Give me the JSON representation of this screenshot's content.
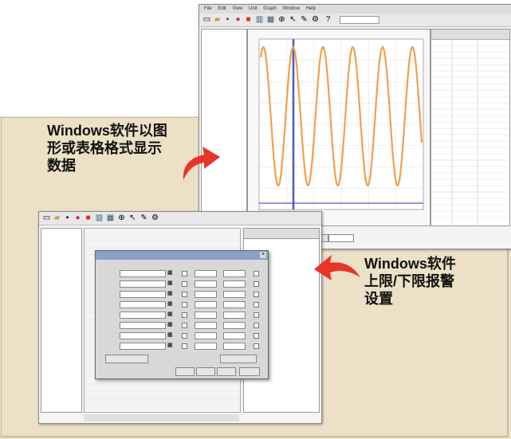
{
  "callout_top": {
    "lines": [
      "Windows软件以图",
      "形或表格格式显示",
      "数据"
    ]
  },
  "callout_bottom": {
    "lines": [
      "Windows软件",
      "上限/下限报警",
      "设置"
    ]
  },
  "chart_window": {
    "menu": [
      "File",
      "Edit",
      "View",
      "Unit",
      "Graph",
      "Window",
      "Help"
    ],
    "tree": {
      "root": "",
      "items": [
        "",
        "",
        "",
        "",
        ""
      ]
    },
    "chart_xlabel": "",
    "status": "",
    "tabs": [
      "",
      ""
    ],
    "table_headers": [
      "",
      "",
      ""
    ]
  },
  "alarm_window": {
    "tree": {
      "items": [
        "",
        ""
      ]
    },
    "dialog": {
      "title": "",
      "col_headers": [
        "",
        "",
        "",
        ""
      ],
      "rows": [
        {
          "label": "",
          "value": ""
        },
        {
          "label": "",
          "value": ""
        },
        {
          "label": "",
          "value": ""
        },
        {
          "label": "",
          "value": ""
        },
        {
          "label": "",
          "value": ""
        },
        {
          "label": "",
          "value": ""
        },
        {
          "label": "",
          "value": ""
        },
        {
          "label": "",
          "value": ""
        }
      ],
      "left_button": "",
      "right_button": "",
      "footer_buttons": [
        "",
        "",
        "",
        ""
      ]
    }
  },
  "colors": {
    "sine": "#f0a050",
    "marker": "#4a5cc0",
    "panel": "#ece0c6",
    "arrow": "#e8342a"
  }
}
